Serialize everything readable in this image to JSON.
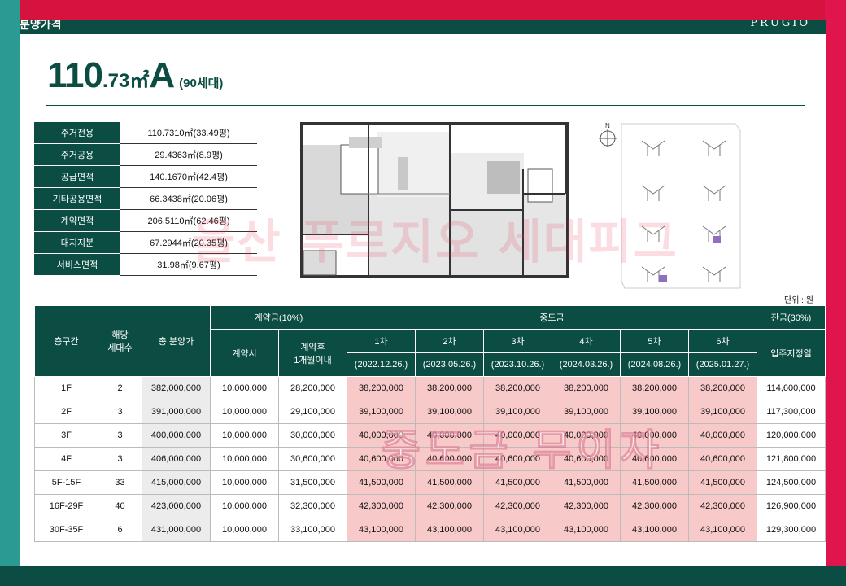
{
  "header": {
    "left_text": "분양가격",
    "brand": "PRUGIO"
  },
  "title": {
    "area_int": "110",
    "area_dec": ".73㎡",
    "type": "A",
    "households": "(90세대)"
  },
  "area_table": [
    {
      "label": "주거전용",
      "value": "110.7310㎡(33.49평)"
    },
    {
      "label": "주거공용",
      "value": "29.4363㎡(8.9평)"
    },
    {
      "label": "공급면적",
      "value": "140.1670㎡(42.4평)"
    },
    {
      "label": "기타공용면적",
      "value": "66.3438㎡(20.06평)"
    },
    {
      "label": "계약면적",
      "value": "206.5110㎡(62.46평)"
    },
    {
      "label": "대지지분",
      "value": "67.2944㎡(20.35평)"
    },
    {
      "label": "서비스면적",
      "value": "31.98㎡(9.67평)"
    }
  ],
  "site_map": {
    "north_label": "N"
  },
  "unit_label": "단위 : 원",
  "pay_header": {
    "floor": "층구간",
    "households": "해당\n세대수",
    "total": "총 분양가",
    "deposit": "계약금(10%)",
    "deposit_at": "계약시",
    "deposit_after": "계약후\n1개월이내",
    "middle": "중도금",
    "balance": "잔금(30%)",
    "balance_when": "입주지정일",
    "rounds": [
      "1차",
      "2차",
      "3차",
      "4차",
      "5차",
      "6차"
    ],
    "dates": [
      "(2022.12.26.)",
      "(2023.05.26.)",
      "(2023.10.26.)",
      "(2024.03.26.)",
      "(2024.08.26.)",
      "(2025.01.27.)"
    ]
  },
  "pay_rows": [
    {
      "floor": "1F",
      "count": "2",
      "total": "382,000,000",
      "d1": "10,000,000",
      "d2": "28,200,000",
      "m": [
        "38,200,000",
        "38,200,000",
        "38,200,000",
        "38,200,000",
        "38,200,000",
        "38,200,000"
      ],
      "bal": "114,600,000"
    },
    {
      "floor": "2F",
      "count": "3",
      "total": "391,000,000",
      "d1": "10,000,000",
      "d2": "29,100,000",
      "m": [
        "39,100,000",
        "39,100,000",
        "39,100,000",
        "39,100,000",
        "39,100,000",
        "39,100,000"
      ],
      "bal": "117,300,000"
    },
    {
      "floor": "3F",
      "count": "3",
      "total": "400,000,000",
      "d1": "10,000,000",
      "d2": "30,000,000",
      "m": [
        "40,000,000",
        "40,000,000",
        "40,000,000",
        "40,000,000",
        "40,000,000",
        "40,000,000"
      ],
      "bal": "120,000,000"
    },
    {
      "floor": "4F",
      "count": "3",
      "total": "406,000,000",
      "d1": "10,000,000",
      "d2": "30,600,000",
      "m": [
        "40,600,000",
        "40,600,000",
        "40,600,000",
        "40,600,000",
        "40,600,000",
        "40,600,000"
      ],
      "bal": "121,800,000"
    },
    {
      "floor": "5F-15F",
      "count": "33",
      "total": "415,000,000",
      "d1": "10,000,000",
      "d2": "31,500,000",
      "m": [
        "41,500,000",
        "41,500,000",
        "41,500,000",
        "41,500,000",
        "41,500,000",
        "41,500,000"
      ],
      "bal": "124,500,000"
    },
    {
      "floor": "16F-29F",
      "count": "40",
      "total": "423,000,000",
      "d1": "10,000,000",
      "d2": "32,300,000",
      "m": [
        "42,300,000",
        "42,300,000",
        "42,300,000",
        "42,300,000",
        "42,300,000",
        "42,300,000"
      ],
      "bal": "126,900,000"
    },
    {
      "floor": "30F-35F",
      "count": "6",
      "total": "431,000,000",
      "d1": "10,000,000",
      "d2": "33,100,000",
      "m": [
        "43,100,000",
        "43,100,000",
        "43,100,000",
        "43,100,000",
        "43,100,000",
        "43,100,000"
      ],
      "bal": "129,300,000"
    }
  ],
  "watermarks": {
    "top": "울산 푸르지오 세대피그",
    "bottom": "중도금 무이자"
  }
}
